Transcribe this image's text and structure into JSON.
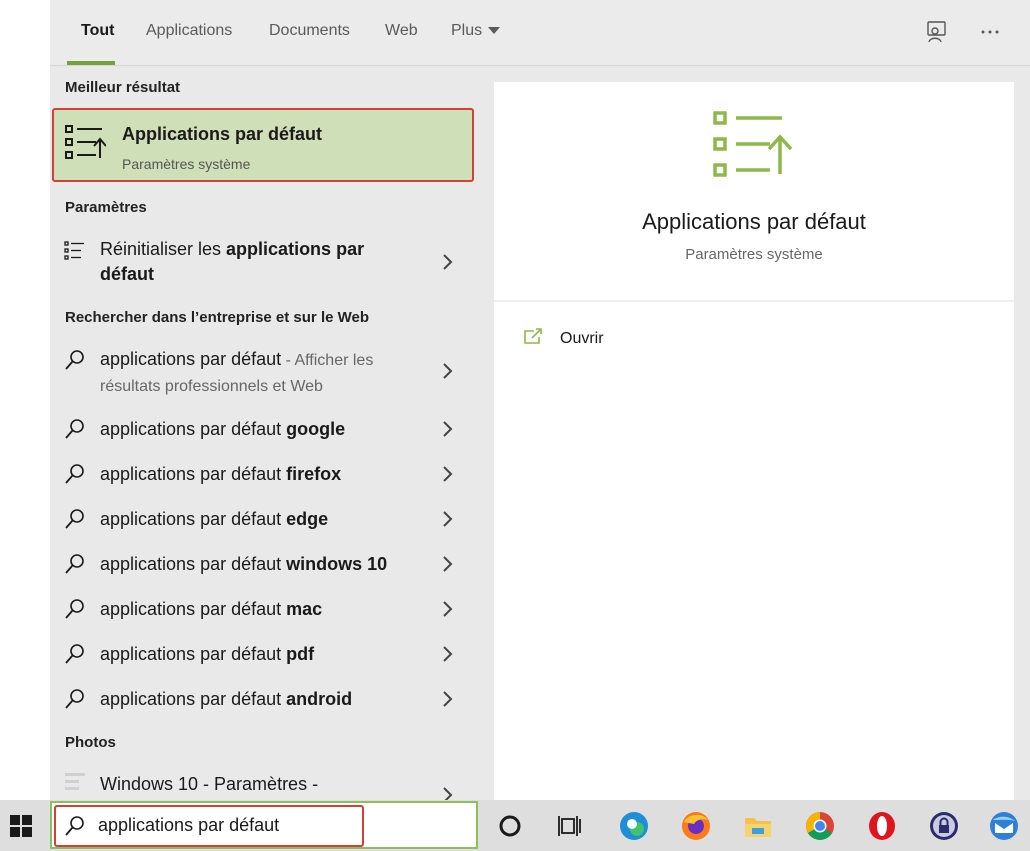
{
  "tabs": [
    {
      "label": "Tout",
      "active": true
    },
    {
      "label": "Applications"
    },
    {
      "label": "Documents"
    },
    {
      "label": "Web"
    },
    {
      "label": "Plus"
    }
  ],
  "icons": {
    "feedback": "feedback-icon",
    "more": "more-options-icon"
  },
  "sections": {
    "best": "Meilleur résultat",
    "settings": "Paramètres",
    "web": "Rechercher dans l’entreprise et sur le Web",
    "photos": "Photos"
  },
  "best_result": {
    "title": "Applications par défaut",
    "subtitle": "Paramètres système"
  },
  "settings_item": {
    "prefix": "Réinitialiser les ",
    "bold1": "applications par",
    "bold2": "défaut"
  },
  "web_first": {
    "text": "applications par défaut",
    "suffix1": " - Afficher les",
    "suffix2": "résultats professionnels et Web"
  },
  "suggestions": [
    {
      "base": "applications par défaut ",
      "bold": "google"
    },
    {
      "base": "applications par défaut ",
      "bold": "firefox"
    },
    {
      "base": "applications par défaut ",
      "bold": "edge"
    },
    {
      "base": "applications par défaut ",
      "bold": "windows 10"
    },
    {
      "base": "applications par défaut ",
      "bold": "mac"
    },
    {
      "base": "applications par défaut ",
      "bold": "pdf"
    },
    {
      "base": "applications par défaut ",
      "bold": "android"
    }
  ],
  "photos_item": "Windows 10 - Paramètres -",
  "detail": {
    "title": "Applications par défaut",
    "subtitle": "Paramètres système",
    "open": "Ouvrir"
  },
  "search": {
    "value": "applications par défaut"
  },
  "colors": {
    "accent": "#73a23e",
    "highlight": "#d2403a",
    "best_bg": "#cfdfb8"
  },
  "taskbar": [
    "windows-start-icon",
    "cortana-icon",
    "task-view-icon",
    "edge-icon",
    "firefox-icon",
    "file-explorer-icon",
    "chrome-icon",
    "opera-icon",
    "vpn-lock-icon",
    "thunderbird-icon"
  ]
}
